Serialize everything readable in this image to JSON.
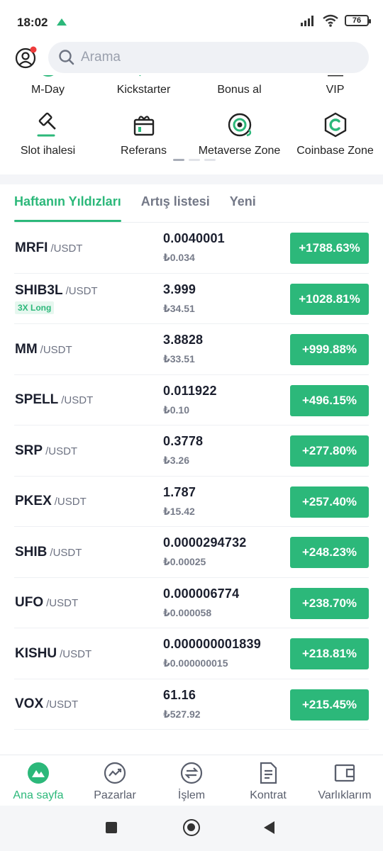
{
  "status_bar": {
    "time": "18:02",
    "battery": "76"
  },
  "header": {
    "search_placeholder": "Arama"
  },
  "shortcuts": {
    "row1": [
      {
        "label": "M-Day",
        "icon": "mday-icon"
      },
      {
        "label": "Kickstarter",
        "icon": "kickstarter-icon"
      },
      {
        "label": "Bonus al",
        "icon": "bonus-icon"
      },
      {
        "label": "VIP",
        "icon": "vip-icon"
      }
    ],
    "row2": [
      {
        "label": "Slot ihalesi",
        "icon": "gavel-icon"
      },
      {
        "label": "Referans",
        "icon": "gift-icon"
      },
      {
        "label": "Metaverse Zone",
        "icon": "metaverse-icon"
      },
      {
        "label": "Coinbase Zone",
        "icon": "coinbase-icon"
      }
    ]
  },
  "tabs": [
    {
      "label": "Haftanın Yıldızları",
      "active": true
    },
    {
      "label": "Artış listesi",
      "active": false
    },
    {
      "label": "Yeni",
      "active": false
    }
  ],
  "market": [
    {
      "symbol": "MRFI",
      "quote": "/USDT",
      "tag": "",
      "price": "0.0040001",
      "local": "₺0.034",
      "change": "+1788.63%"
    },
    {
      "symbol": "SHIB3L",
      "quote": "/USDT",
      "tag": "3X Long",
      "price": "3.999",
      "local": "₺34.51",
      "change": "+1028.81%"
    },
    {
      "symbol": "MM",
      "quote": "/USDT",
      "tag": "",
      "price": "3.8828",
      "local": "₺33.51",
      "change": "+999.88%"
    },
    {
      "symbol": "SPELL",
      "quote": "/USDT",
      "tag": "",
      "price": "0.011922",
      "local": "₺0.10",
      "change": "+496.15%"
    },
    {
      "symbol": "SRP",
      "quote": "/USDT",
      "tag": "",
      "price": "0.3778",
      "local": "₺3.26",
      "change": "+277.80%"
    },
    {
      "symbol": "PKEX",
      "quote": "/USDT",
      "tag": "",
      "price": "1.787",
      "local": "₺15.42",
      "change": "+257.40%"
    },
    {
      "symbol": "SHIB",
      "quote": "/USDT",
      "tag": "",
      "price": "0.0000294732",
      "local": "₺0.00025",
      "change": "+248.23%"
    },
    {
      "symbol": "UFO",
      "quote": "/USDT",
      "tag": "",
      "price": "0.000006774",
      "local": "₺0.000058",
      "change": "+238.70%"
    },
    {
      "symbol": "KISHU",
      "quote": "/USDT",
      "tag": "",
      "price": "0.000000001839",
      "local": "₺0.000000015",
      "change": "+218.81%"
    },
    {
      "symbol": "VOX",
      "quote": "/USDT",
      "tag": "",
      "price": "61.16",
      "local": "₺527.92",
      "change": "+215.45%"
    }
  ],
  "bottom_nav": [
    {
      "label": "Ana sayfa",
      "icon": "home-icon",
      "active": true
    },
    {
      "label": "Pazarlar",
      "icon": "markets-icon",
      "active": false
    },
    {
      "label": "İşlem",
      "icon": "trade-icon",
      "active": false
    },
    {
      "label": "Kontrat",
      "icon": "contract-icon",
      "active": false
    },
    {
      "label": "Varlıklarım",
      "icon": "wallet-icon",
      "active": false
    }
  ],
  "colors": {
    "accent": "#2cb87a",
    "text": "#1b1f2e",
    "muted": "#737887"
  }
}
